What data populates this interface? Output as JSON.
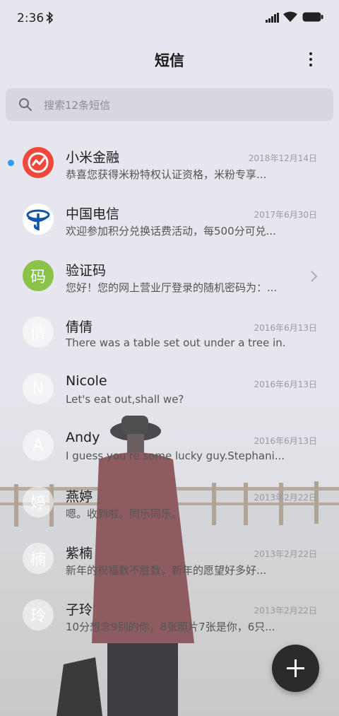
{
  "status_bar": {
    "time": "2:36",
    "icons": [
      "bluetooth-icon",
      "signal-icon",
      "wifi-icon",
      "battery-icon"
    ]
  },
  "app_bar": {
    "title": "短信",
    "menu_icon": "more-vertical-icon"
  },
  "search": {
    "placeholder": "搜索12条短信",
    "icon": "search-icon"
  },
  "conversations": [
    {
      "name": "小米金融",
      "date": "2018年12月14日",
      "preview": "恭喜您获得米粉特权认证资格，米粉专享...",
      "unread": true,
      "avatar": "xiaomi-finance-logo"
    },
    {
      "name": "中国电信",
      "date": "2017年6月30日",
      "preview": "欢迎参加积分兑换话费活动，每500分可兑...",
      "unread": false,
      "avatar": "china-telecom-logo"
    },
    {
      "name": "验证码",
      "date": "",
      "preview": "您好！您的网上营业厅登录的随机密码为：...",
      "unread": false,
      "avatar_text": "码",
      "avatar_color": "#8bc34a"
    },
    {
      "name": "倩倩",
      "date": "2016年6月13日",
      "preview": "There was a table set out under a tree in...",
      "avatar_text": "倩"
    },
    {
      "name": "Nicole",
      "date": "2016年6月13日",
      "preview": "Let's eat out,shall we?",
      "avatar_text": "N"
    },
    {
      "name": "Andy",
      "date": "2016年6月13日",
      "preview": "I guess you're some lucky guy.Stephani...",
      "avatar_text": "A"
    },
    {
      "name": "燕婷",
      "date": "2013年2月22日",
      "preview": "嗯。收到啦。同乐同乐。",
      "avatar_text": "婷"
    },
    {
      "name": "紫楠",
      "date": "2013年2月22日",
      "preview": "新年的祝福数不胜数，新年的愿望好多好...",
      "avatar_text": "楠"
    },
    {
      "name": "子玲",
      "date": "2013年2月22日",
      "preview": "10分想念9别的你，8张照片7张是你，6只...",
      "avatar_text": "玲"
    }
  ],
  "fab": {
    "icon": "plus-icon"
  },
  "colors": {
    "unread_dot": "#2f9cf3",
    "xiaomi_red": "#f0483c",
    "telecom_blue": "#1155a6",
    "verify_green": "#8bc34a",
    "fab_bg": "#2b2b2b"
  }
}
